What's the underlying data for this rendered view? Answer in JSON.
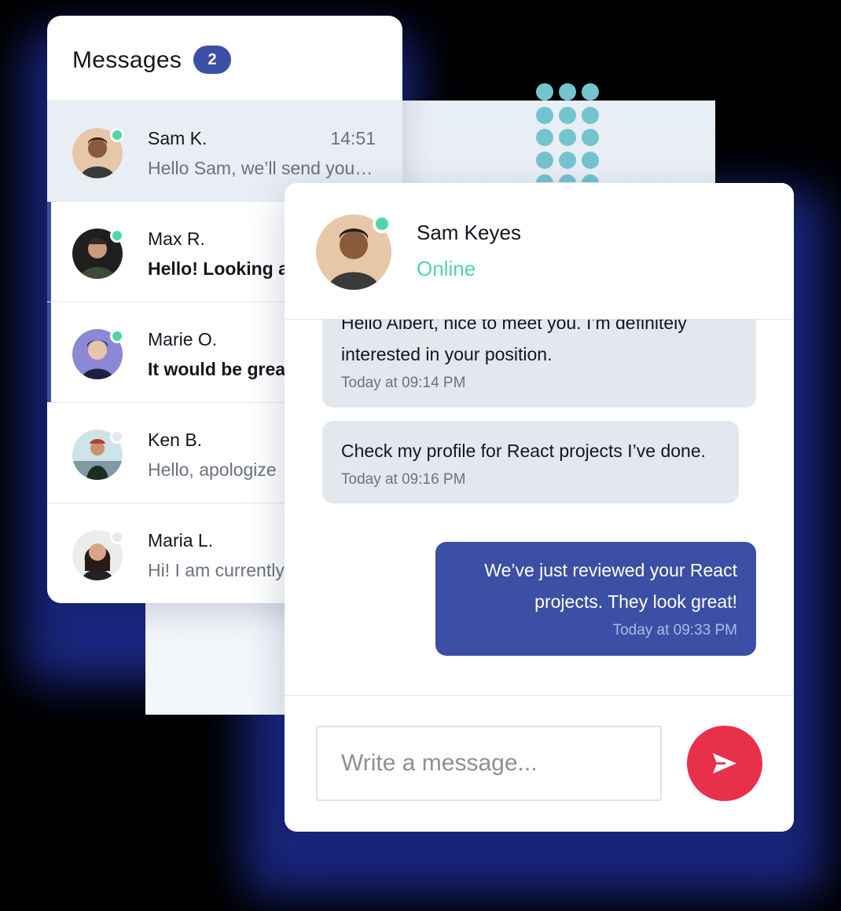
{
  "colors": {
    "accent": "#3b4fa5",
    "online": "#4fd6a6",
    "send": "#e8304a",
    "bubble_in": "#e3e8ee",
    "bubble_out": "#3b4fa5"
  },
  "messages_list": {
    "title": "Messages",
    "unread_count": "2",
    "conversations": [
      {
        "name": "Sam K.",
        "time": "14:51",
        "preview": "Hello Sam, we’ll send you…",
        "active": true,
        "unread": false,
        "online": true
      },
      {
        "name": "Max R.",
        "time": "",
        "preview": "Hello! Looking a",
        "active": false,
        "unread": true,
        "online": true
      },
      {
        "name": "Marie O.",
        "time": "",
        "preview": "It would be great",
        "active": false,
        "unread": true,
        "online": true
      },
      {
        "name": "Ken B.",
        "time": "",
        "preview": "Hello, apologize",
        "active": false,
        "unread": false,
        "online": false
      },
      {
        "name": "Maria L.",
        "time": "",
        "preview": "Hi! I am currently",
        "active": false,
        "unread": false,
        "online": false
      }
    ]
  },
  "chat": {
    "contact_name": "Sam Keyes",
    "contact_status": "Online",
    "messages": [
      {
        "direction": "incoming",
        "lines": [
          "Hello Albert, nice to meet you. I’m definitely",
          "interested in your position."
        ],
        "time": "Today at 09:14 PM"
      },
      {
        "direction": "incoming",
        "lines": [
          "Check my profile for React projects I’ve done."
        ],
        "time": "Today at 09:16 PM"
      },
      {
        "direction": "outgoing",
        "lines": [
          "We’ve just reviewed your React",
          "projects. They look great!"
        ],
        "time": "Today at 09:33 PM"
      }
    ],
    "composer": {
      "placeholder": "Write a message...",
      "value": ""
    }
  },
  "icons": {
    "send": "send-arrow-icon",
    "avatar": "person-avatar-icon",
    "decor": "dot-grid"
  }
}
